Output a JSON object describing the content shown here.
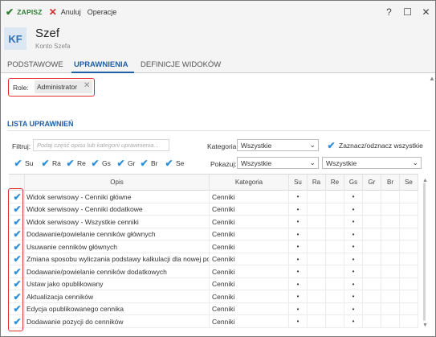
{
  "toolbar": {
    "save_label": "ZAPISZ",
    "cancel_label": "Anuluj",
    "operations_label": "Operacje"
  },
  "window_buttons": {
    "help": "?",
    "maximize": "☐",
    "close": "✕"
  },
  "header": {
    "initials": "KF",
    "title": "Szef",
    "subtitle": "Konto Szefa"
  },
  "tabs": [
    {
      "label": "PODSTAWOWE",
      "active": false
    },
    {
      "label": "UPRAWNIENIA",
      "active": true
    },
    {
      "label": "DEFINICJE WIDOKÓW",
      "active": false
    }
  ],
  "roles": {
    "label": "Role:",
    "chips": [
      "Administrator"
    ]
  },
  "section_title": "LISTA UPRAWNIEŃ",
  "filters": {
    "filter_label": "Filtruj:",
    "filter_placeholder": "Podaj część opisu lub kategorii uprawnienia...",
    "category_label": "Kategoria:",
    "category_value": "Wszystkie",
    "toggle_all_label": "Zaznacz/odznacz wszystkie",
    "show_label": "Pokazuj:",
    "show_value": "Wszystkie",
    "third_value": "Wszystkie",
    "flag_checks": [
      "Su",
      "Ra",
      "Re",
      "Gs",
      "Gr",
      "Br",
      "Se"
    ]
  },
  "table": {
    "columns": [
      "Opis",
      "Kategoria",
      "Su",
      "Ra",
      "Re",
      "Gs",
      "Gr",
      "Br",
      "Se"
    ],
    "rows": [
      {
        "opis": "Widok serwisowy - Cenniki główne",
        "kategoria": "Cenniki",
        "su": "•",
        "gs": "•"
      },
      {
        "opis": "Widok serwisowy - Cenniki dodatkowe",
        "kategoria": "Cenniki",
        "su": "•",
        "gs": "•"
      },
      {
        "opis": "Widok serwisowy - Wszystkie cenniki",
        "kategoria": "Cenniki",
        "su": "•",
        "gs": "•"
      },
      {
        "opis": "Dodawanie/powielanie cenników głównych",
        "kategoria": "Cenniki",
        "su": "•",
        "gs": "•"
      },
      {
        "opis": "Usuwanie cenników głównych",
        "kategoria": "Cenniki",
        "su": "•",
        "gs": "•"
      },
      {
        "opis": "Zmiana sposobu wyliczania podstawy kalkulacji dla nowej po...",
        "kategoria": "Cenniki",
        "su": "•",
        "gs": "•"
      },
      {
        "opis": "Dodawanie/powielanie cenników dodatkowych",
        "kategoria": "Cenniki",
        "su": "•",
        "gs": "•"
      },
      {
        "opis": "Ustaw jako opublikowany",
        "kategoria": "Cenniki",
        "su": "•",
        "gs": "•"
      },
      {
        "opis": "Aktualizacja cenników",
        "kategoria": "Cenniki",
        "su": "•",
        "gs": "•"
      },
      {
        "opis": "Edycja opublikowanego cennika",
        "kategoria": "Cenniki",
        "su": "•",
        "gs": "•"
      },
      {
        "opis": "Dodawanie pozycji do cenników",
        "kategoria": "Cenniki",
        "su": "•",
        "gs": "•"
      }
    ]
  },
  "colors": {
    "accent": "#1f5fa6",
    "check": "#2f8fd8",
    "save": "#2e7d32",
    "cancel": "#d32f2f",
    "highlight": "#e03030"
  }
}
